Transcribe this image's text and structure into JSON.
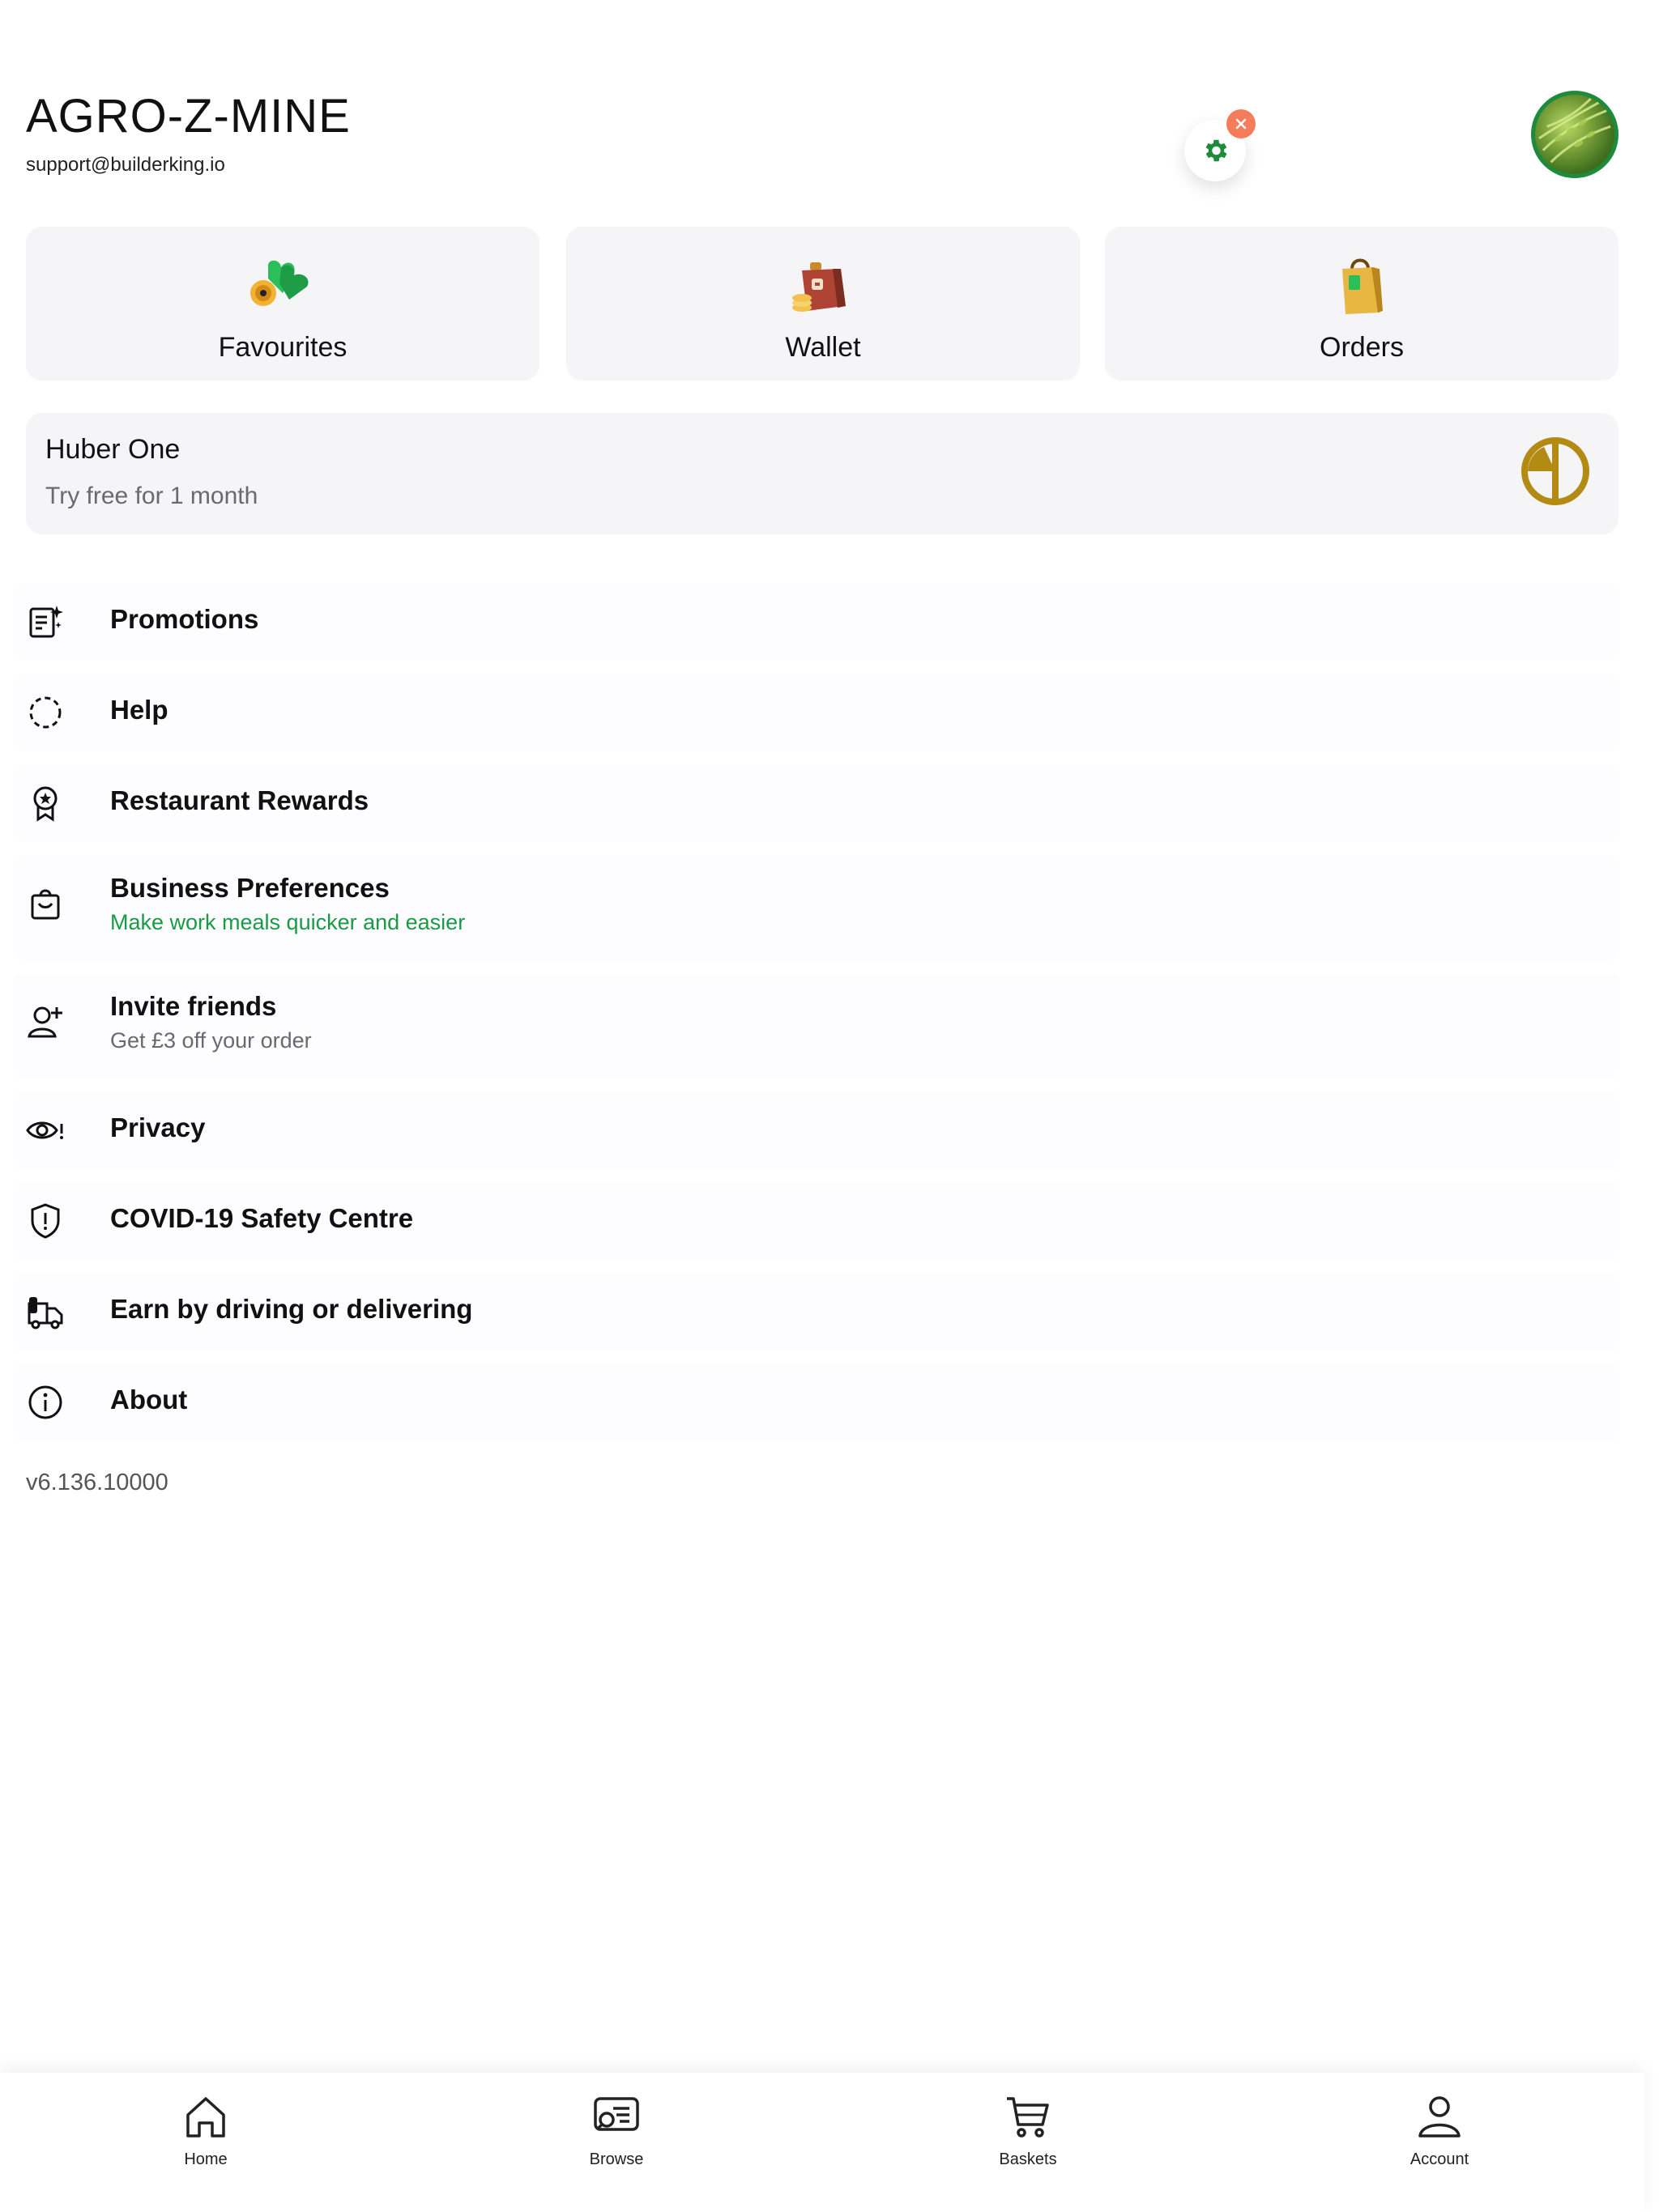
{
  "header": {
    "title": "AGRO-Z-MINE",
    "email": "support@builderking.io"
  },
  "icons": {
    "settings": "gear-icon",
    "close": "close-icon",
    "avatar": "profile-avatar"
  },
  "colors": {
    "accent_green": "#1e8a3c",
    "close_orange": "#f47c5a",
    "promo_gold": "#b38a12",
    "subtitle_green": "#1a9a47"
  },
  "tiles": [
    {
      "label": "Favourites",
      "icon": "favourites-icon"
    },
    {
      "label": "Wallet",
      "icon": "wallet-icon"
    },
    {
      "label": "Orders",
      "icon": "orders-icon"
    }
  ],
  "promo": {
    "title": "Huber One",
    "subtitle": "Try free for 1 month",
    "icon": "huber-one-logo"
  },
  "menu": [
    {
      "title": "Promotions",
      "subtitle": "",
      "icon": "promotions-icon"
    },
    {
      "title": "Help",
      "subtitle": "",
      "icon": "help-icon"
    },
    {
      "title": "Restaurant Rewards",
      "subtitle": "",
      "icon": "rewards-icon"
    },
    {
      "title": "Business Preferences",
      "subtitle": "Make work meals quicker and easier",
      "icon": "briefcase-icon"
    },
    {
      "title": "Invite friends",
      "subtitle": "Get £3 off your order",
      "icon": "add-user-icon"
    },
    {
      "title": "Privacy",
      "subtitle": "",
      "icon": "privacy-eye-icon"
    },
    {
      "title": "COVID-19 Safety Centre",
      "subtitle": "",
      "icon": "shield-alert-icon"
    },
    {
      "title": "Earn by driving or delivering",
      "subtitle": "",
      "icon": "delivery-truck-icon"
    },
    {
      "title": "About",
      "subtitle": "",
      "icon": "info-icon"
    }
  ],
  "version": "v6.136.10000",
  "bottom_nav": [
    {
      "label": "Home",
      "icon": "home-icon"
    },
    {
      "label": "Browse",
      "icon": "browse-icon"
    },
    {
      "label": "Baskets",
      "icon": "cart-icon"
    },
    {
      "label": "Account",
      "icon": "account-icon"
    }
  ]
}
